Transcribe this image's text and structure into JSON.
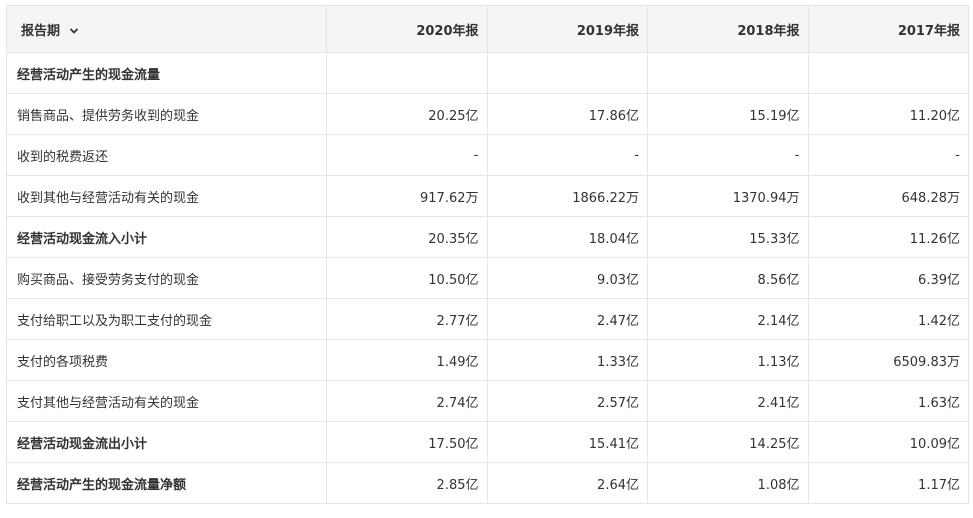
{
  "header": {
    "period_label": "报告期",
    "years": [
      "2020年报",
      "2019年报",
      "2018年报",
      "2017年报"
    ]
  },
  "rows": [
    {
      "label": "经营活动产生的现金流量",
      "bold": true,
      "values": [
        "",
        "",
        "",
        ""
      ]
    },
    {
      "label": "销售商品、提供劳务收到的现金",
      "bold": false,
      "values": [
        "20.25亿",
        "17.86亿",
        "15.19亿",
        "11.20亿"
      ]
    },
    {
      "label": "收到的税费返还",
      "bold": false,
      "values": [
        "-",
        "-",
        "-",
        "-"
      ]
    },
    {
      "label": "收到其他与经营活动有关的现金",
      "bold": false,
      "values": [
        "917.62万",
        "1866.22万",
        "1370.94万",
        "648.28万"
      ]
    },
    {
      "label": "经营活动现金流入小计",
      "bold": true,
      "values": [
        "20.35亿",
        "18.04亿",
        "15.33亿",
        "11.26亿"
      ]
    },
    {
      "label": "购买商品、接受劳务支付的现金",
      "bold": false,
      "values": [
        "10.50亿",
        "9.03亿",
        "8.56亿",
        "6.39亿"
      ]
    },
    {
      "label": "支付给职工以及为职工支付的现金",
      "bold": false,
      "values": [
        "2.77亿",
        "2.47亿",
        "2.14亿",
        "1.42亿"
      ]
    },
    {
      "label": "支付的各项税费",
      "bold": false,
      "values": [
        "1.49亿",
        "1.33亿",
        "1.13亿",
        "6509.83万"
      ]
    },
    {
      "label": "支付其他与经营活动有关的现金",
      "bold": false,
      "values": [
        "2.74亿",
        "2.57亿",
        "2.41亿",
        "1.63亿"
      ]
    },
    {
      "label": "经营活动现金流出小计",
      "bold": true,
      "values": [
        "17.50亿",
        "15.41亿",
        "14.25亿",
        "10.09亿"
      ]
    },
    {
      "label": "经营活动产生的现金流量净额",
      "bold": true,
      "values": [
        "2.85亿",
        "2.64亿",
        "1.08亿",
        "1.17亿"
      ]
    }
  ]
}
